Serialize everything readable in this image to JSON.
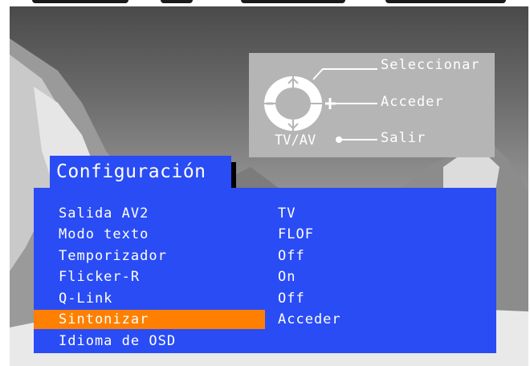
{
  "controls": {
    "select_label": "Seleccionar",
    "enter_label": "Acceder",
    "exit_label": "Salir",
    "tvav_label": "TV/AV",
    "up_symbol": "^",
    "down_symbol": "v",
    "minus_symbol": "−",
    "plus_symbol": "+"
  },
  "menu": {
    "title": "Configuración",
    "highlight_color": "#ff7f00",
    "panel_color": "#2a4cf5",
    "items": [
      {
        "label": "Salida AV2",
        "value": "TV",
        "selected": false
      },
      {
        "label": "Modo texto",
        "value": "FLOF",
        "selected": false
      },
      {
        "label": "Temporizador",
        "value": "Off",
        "selected": false
      },
      {
        "label": "Flicker-R",
        "value": "On",
        "selected": false
      },
      {
        "label": "Q-Link",
        "value": "Off",
        "selected": false
      },
      {
        "label": "Sintonizar",
        "value": "Acceder",
        "selected": true
      },
      {
        "label": "Idioma de OSD",
        "value": "",
        "selected": false
      }
    ]
  }
}
